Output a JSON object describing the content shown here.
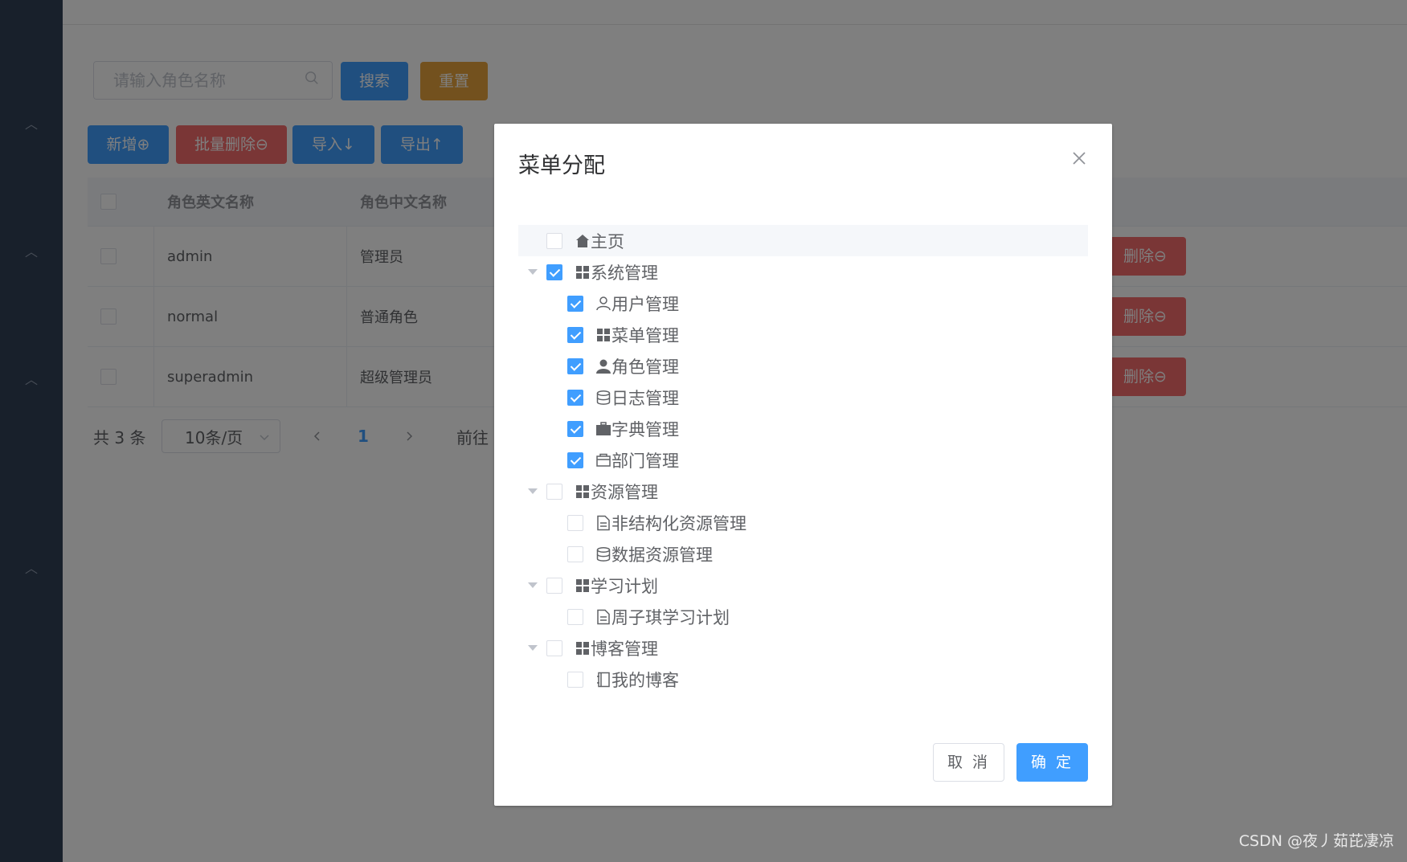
{
  "search": {
    "placeholder": "请输入角色名称",
    "search_label": "搜索",
    "reset_label": "重置"
  },
  "toolbar": {
    "add_label": "新增⊕",
    "batch_delete_label": "批量删除⊖",
    "import_label": "导入↓",
    "export_label": "导出↑"
  },
  "table": {
    "columns": [
      "角色英文名称",
      "角色中文名称"
    ],
    "rows": [
      {
        "en": "admin",
        "cn": "管理员",
        "delete_label": "删除⊖"
      },
      {
        "en": "normal",
        "cn": "普通角色",
        "delete_label": "删除⊖"
      },
      {
        "en": "superadmin",
        "cn": "超级管理员",
        "delete_label": "删除⊖"
      }
    ]
  },
  "pagination": {
    "total_text": "共 3 条",
    "page_size": "10条/页",
    "current_page": "1",
    "goto_text": "前往"
  },
  "dialog": {
    "title": "菜单分配",
    "cancel_label": "取 消",
    "ok_label": "确 定",
    "tree": [
      {
        "label": "主页",
        "icon": "home-icon",
        "checked": false,
        "level": 0,
        "has_children": false
      },
      {
        "label": "系统管理",
        "icon": "grid-icon",
        "checked": true,
        "level": 0,
        "has_children": true
      },
      {
        "label": "用户管理",
        "icon": "user-outline-icon",
        "checked": true,
        "level": 1
      },
      {
        "label": "菜单管理",
        "icon": "grid-icon",
        "checked": true,
        "level": 1
      },
      {
        "label": "角色管理",
        "icon": "user-solid-icon",
        "checked": true,
        "level": 1
      },
      {
        "label": "日志管理",
        "icon": "database-icon",
        "checked": true,
        "level": 1
      },
      {
        "label": "字典管理",
        "icon": "suitcase-icon",
        "checked": true,
        "level": 1
      },
      {
        "label": "部门管理",
        "icon": "folder-icon",
        "checked": true,
        "level": 1
      },
      {
        "label": "资源管理",
        "icon": "grid-icon",
        "checked": false,
        "level": 0,
        "has_children": true
      },
      {
        "label": "非结构化资源管理",
        "icon": "document-icon",
        "checked": false,
        "level": 1
      },
      {
        "label": "数据资源管理",
        "icon": "database-icon",
        "checked": false,
        "level": 1
      },
      {
        "label": "学习计划",
        "icon": "grid-icon",
        "checked": false,
        "level": 0,
        "has_children": true
      },
      {
        "label": "周子琪学习计划",
        "icon": "document-icon",
        "checked": false,
        "level": 1
      },
      {
        "label": "博客管理",
        "icon": "grid-icon",
        "checked": false,
        "level": 0,
        "has_children": true
      },
      {
        "label": "我的博客",
        "icon": "notebook-icon",
        "checked": false,
        "level": 1
      }
    ]
  },
  "watermark": "CSDN @夜丿茹芘凄凉",
  "colors": {
    "primary": "#409eff",
    "danger": "#f56c6c",
    "warning": "#e6a23c",
    "sidebar": "#304156"
  }
}
